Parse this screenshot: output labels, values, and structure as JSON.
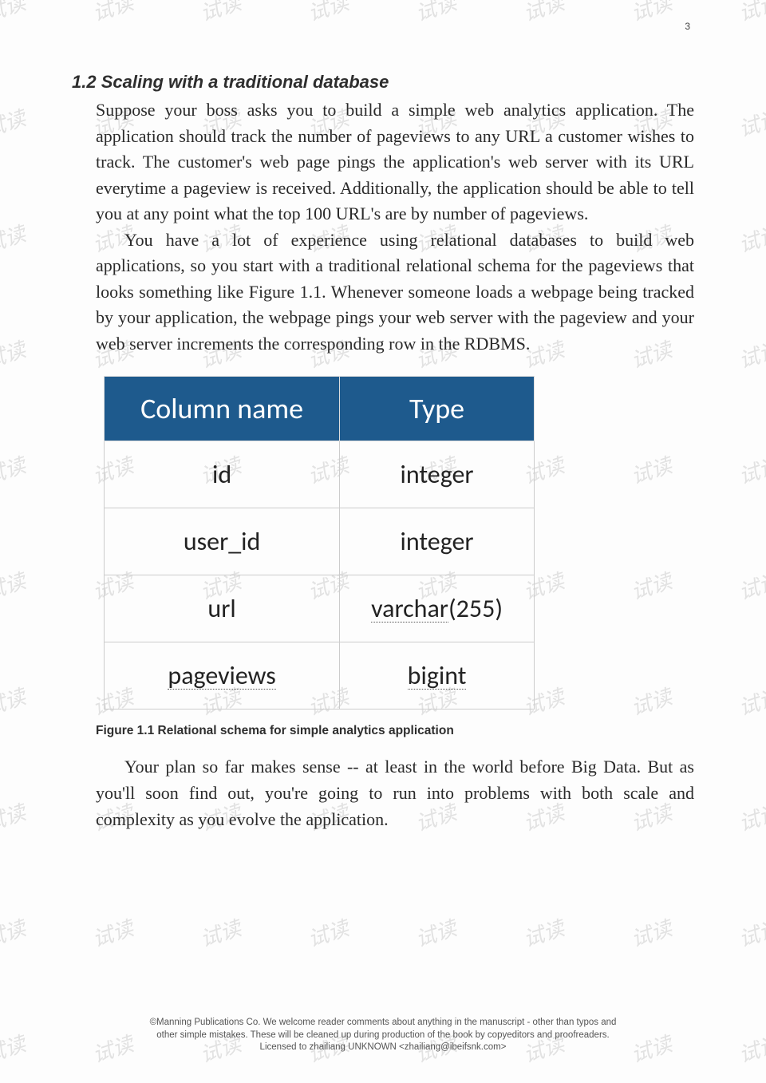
{
  "page_number": "3",
  "watermark_text": "试读",
  "heading": "1.2 Scaling with a traditional database",
  "paragraphs": {
    "p1": "Suppose your boss asks you to build a simple web analytics application. The application should track the number of pageviews to any URL a customer wishes to track. The customer's web page pings the application's web server with its URL everytime a pageview is received. Additionally, the application should be able to tell you at any point what the top 100 URL's are by number of pageviews.",
    "p2": "You have a lot of experience using relational databases to build web applications, so you start with a traditional relational schema for the pageviews that looks something like Figure 1.1. Whenever someone loads a webpage being tracked by your application, the webpage pings your web server with the pageview and your web server increments the corresponding row in the RDBMS.",
    "p3": "Your plan so far makes sense -- at least in the world before Big Data. But as you'll soon find out, you're going to run into problems with both scale and complexity as you evolve the application."
  },
  "table": {
    "headers": {
      "col1": "Column name",
      "col2": "Type"
    },
    "rows": [
      {
        "name": "id",
        "type": "integer",
        "name_underline": false,
        "type_underline": false
      },
      {
        "name": "user_id",
        "type": "integer",
        "name_underline": false,
        "type_underline": false
      },
      {
        "name": "url",
        "type_prefix": "varchar",
        "type_suffix": "(255)",
        "name_underline": false,
        "type_underline": true
      },
      {
        "name": "pageviews",
        "type": "bigint",
        "name_underline": true,
        "type_underline": true
      }
    ]
  },
  "caption": "Figure 1.1 Relational schema for simple analytics application",
  "footer": {
    "line1": "©Manning Publications Co. We welcome reader comments about anything in the manuscript - other than typos and",
    "line2": "other simple mistakes. These will be cleaned up during production of the book by copyeditors and proofreaders.",
    "line3": "Licensed to zhailiang UNKNOWN <zhailiang@ibeifsnk.com>"
  }
}
